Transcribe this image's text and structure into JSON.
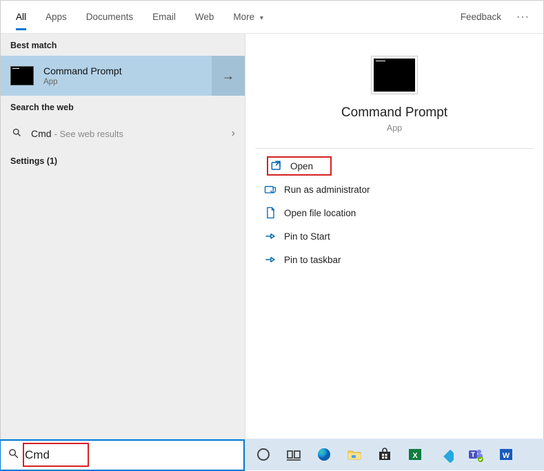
{
  "tabs": {
    "all": "All",
    "apps": "Apps",
    "documents": "Documents",
    "email": "Email",
    "web": "Web",
    "more": "More"
  },
  "feedback": "Feedback",
  "left": {
    "best_match": "Best match",
    "result": {
      "title": "Command Prompt",
      "subtitle": "App"
    },
    "search_web": "Search the web",
    "web_result": {
      "query": "Cmd",
      "hint": "See web results"
    },
    "settings": "Settings (1)"
  },
  "preview": {
    "title": "Command Prompt",
    "subtitle": "App"
  },
  "actions": {
    "open": "Open",
    "run_admin": "Run as administrator",
    "open_location": "Open file location",
    "pin_start": "Pin to Start",
    "pin_taskbar": "Pin to taskbar"
  },
  "search": {
    "value": "Cmd"
  }
}
